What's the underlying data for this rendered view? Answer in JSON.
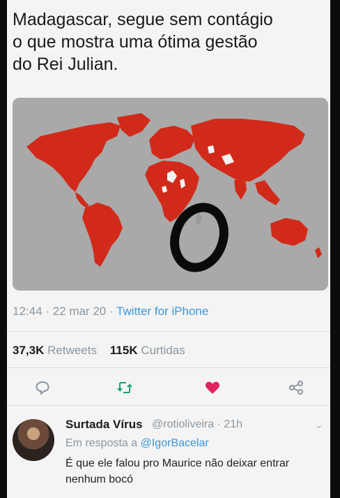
{
  "tweet": {
    "text": "Madagascar, segue sem contágio\no que mostra uma ótima gestão\ndo Rei Julian.",
    "time": "12:44",
    "date": "22 mar 20",
    "separator": "·",
    "source": "Twitter for iPhone"
  },
  "stats": {
    "retweets_count": "37,3K",
    "retweets_label": "Retweets",
    "likes_count": "115K",
    "likes_label": "Curtidas"
  },
  "actions": {
    "reply_icon": "comment-icon",
    "retweet_icon": "retweet-icon",
    "like_icon": "heart-icon",
    "share_icon": "share-icon"
  },
  "reply": {
    "name": "Surtada Vírus",
    "handle": "@rotioliveira · 21h",
    "in_reply_prefix": "Em resposta a",
    "in_reply_mention": "@IgorBacelar",
    "text": "É que ele falou pro Maurice não deixar entrar  nenhum bocó"
  },
  "colors": {
    "map_fill": "#d22a1a",
    "map_background": "#a9a9a9",
    "link": "#3d95d8",
    "retweet": "#18a572",
    "like": "#e0245e"
  }
}
